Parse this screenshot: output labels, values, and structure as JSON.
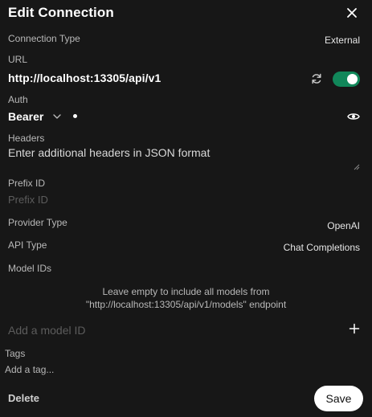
{
  "modal": {
    "title": "Edit Connection",
    "close_icon": "close-icon"
  },
  "connection_type": {
    "label": "Connection Type",
    "value": "External"
  },
  "url": {
    "label": "URL",
    "value": "http://localhost:13305/api/v1",
    "refresh_icon": "refresh-icon",
    "enabled": true,
    "toggle_color": "#11875a"
  },
  "auth": {
    "label": "Auth",
    "type": "Bearer",
    "key_masked": "•",
    "eye_icon": "eye-icon"
  },
  "headers": {
    "label": "Headers",
    "placeholder": "Enter additional headers in JSON format"
  },
  "prefix_id": {
    "label": "Prefix ID",
    "placeholder": "Prefix ID"
  },
  "provider_type": {
    "label": "Provider Type",
    "value": "OpenAI"
  },
  "api_type": {
    "label": "API Type",
    "value": "Chat Completions"
  },
  "model_ids": {
    "label": "Model IDs",
    "hint_line1": "Leave empty to include all models from",
    "hint_line2": "\"http://localhost:13305/api/v1/models\" endpoint",
    "placeholder": "Add a model ID"
  },
  "tags": {
    "label": "Tags",
    "placeholder": "Add a tag..."
  },
  "footer": {
    "delete_label": "Delete",
    "save_label": "Save"
  }
}
